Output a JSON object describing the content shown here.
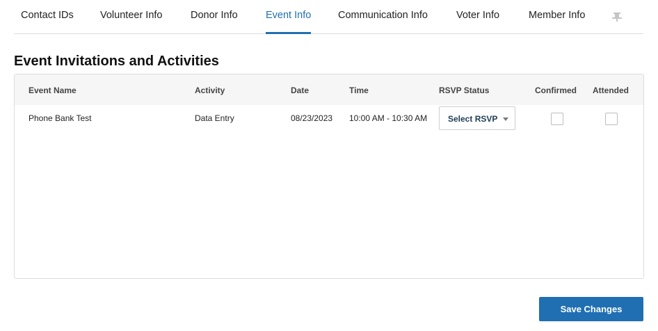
{
  "tabs": [
    {
      "label": "Contact IDs",
      "active": false
    },
    {
      "label": "Volunteer Info",
      "active": false
    },
    {
      "label": "Donor Info",
      "active": false
    },
    {
      "label": "Event Info",
      "active": true
    },
    {
      "label": "Communication Info",
      "active": false
    },
    {
      "label": "Voter Info",
      "active": false
    },
    {
      "label": "Member Info",
      "active": false
    }
  ],
  "pin_icon": "pushpin-icon",
  "section": {
    "title": "Event Invitations and Activities"
  },
  "table": {
    "columns": [
      "Event Name",
      "Activity",
      "Date",
      "Time",
      "RSVP Status",
      "Confirmed",
      "Attended"
    ],
    "rows": [
      {
        "event_name": "Phone Bank Test",
        "activity": "Data Entry",
        "date": "08/23/2023",
        "time": "10:00 AM - 10:30 AM",
        "rsvp_status": "Select RSVP",
        "confirmed": false,
        "attended": false
      }
    ]
  },
  "actions": {
    "save_label": "Save Changes"
  },
  "colors": {
    "accent": "#1f6fb2",
    "header_bg": "#f6f6f6",
    "border": "#dcdcdc"
  }
}
